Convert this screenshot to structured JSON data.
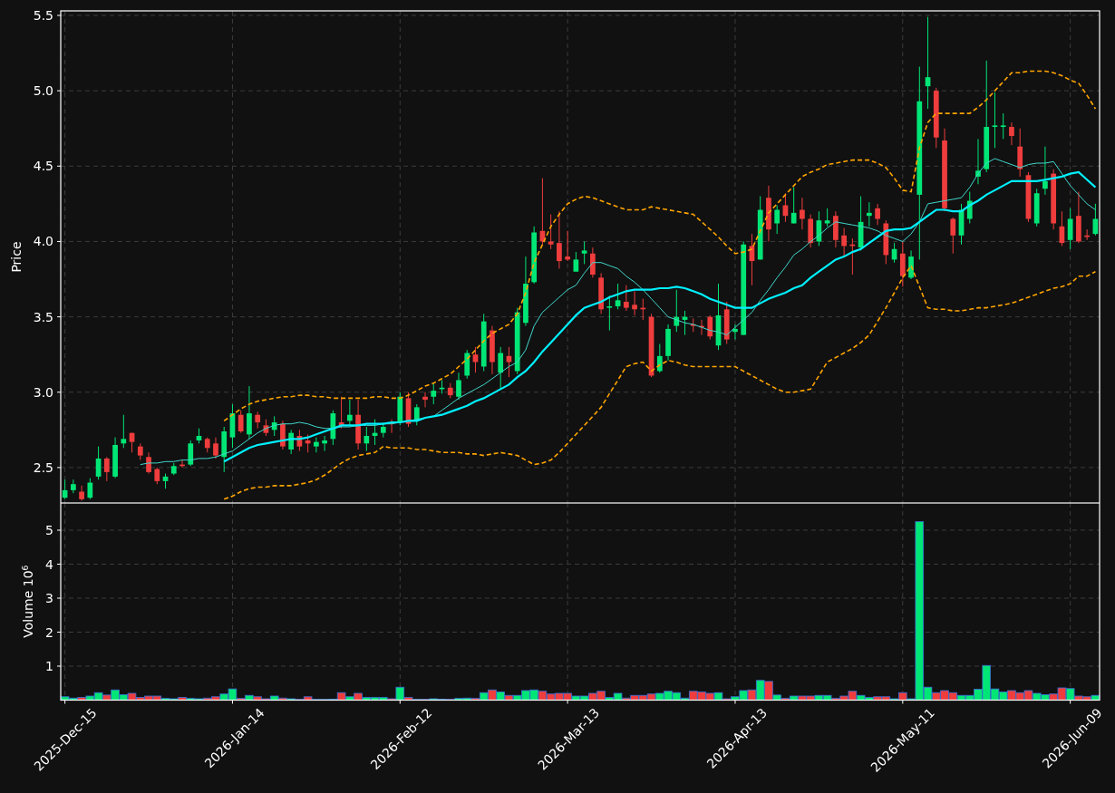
{
  "charts": [
    {
      "chart_data": {
        "type": "candlestick",
        "ylabel": "Price",
        "grid": true,
        "ylim": [
          2.265,
          5.53
        ],
        "categories": [
          null,
          null,
          null,
          null,
          null,
          null,
          null,
          null,
          null,
          null,
          null,
          null,
          null,
          null,
          null,
          null,
          null,
          null,
          null,
          null,
          null,
          null,
          null,
          null,
          null,
          null,
          null,
          null,
          null,
          null,
          null,
          null,
          null,
          null,
          null,
          null,
          null,
          null,
          null,
          null,
          null,
          null,
          null,
          null,
          null,
          null,
          null,
          null,
          null,
          null,
          null,
          null,
          null,
          null,
          null,
          null,
          null,
          null,
          null,
          null,
          null,
          null,
          null,
          null,
          null,
          null,
          null,
          null,
          null,
          null,
          null,
          null,
          null,
          null,
          null,
          null,
          null,
          null,
          null,
          null,
          null,
          null,
          null,
          null,
          null,
          null,
          null,
          null,
          null,
          null,
          null,
          null,
          null,
          null,
          null,
          null,
          null,
          null,
          null,
          null,
          null,
          null,
          null,
          null,
          null,
          null,
          null,
          null,
          null,
          null,
          null,
          null,
          null,
          null,
          null,
          null,
          null,
          null,
          null,
          null,
          null,
          null,
          null,
          null
        ],
        "yticks": [
          {
            "value": 2.5,
            "label": "2.5"
          },
          {
            "value": 3,
            "label": "3.0"
          },
          {
            "value": 3.5,
            "label": "3.5"
          },
          {
            "value": 4,
            "label": "4.0"
          },
          {
            "value": 4.5,
            "label": "4.5"
          },
          {
            "value": 5,
            "label": "5.0"
          },
          {
            "value": 5.5,
            "label": "5.5"
          }
        ],
        "ohlc": [
          [
            2.3,
            2.42,
            2.29,
            2.35
          ],
          [
            2.35,
            2.42,
            2.33,
            2.39
          ],
          [
            2.34,
            2.38,
            2.28,
            2.29
          ],
          [
            2.3,
            2.43,
            2.29,
            2.4
          ],
          [
            2.44,
            2.64,
            2.42,
            2.56
          ],
          [
            2.56,
            2.57,
            2.41,
            2.47
          ],
          [
            2.44,
            2.7,
            2.43,
            2.65
          ],
          [
            2.66,
            2.85,
            2.63,
            2.69
          ],
          [
            2.73,
            2.73,
            2.6,
            2.67
          ],
          [
            2.64,
            2.66,
            2.55,
            2.58
          ],
          [
            2.57,
            2.6,
            2.46,
            2.47
          ],
          [
            2.49,
            2.5,
            2.39,
            2.41
          ],
          [
            2.41,
            2.46,
            2.36,
            2.44
          ],
          [
            2.46,
            2.53,
            2.45,
            2.51
          ],
          [
            2.52,
            2.55,
            2.5,
            2.51
          ],
          [
            2.52,
            2.68,
            2.51,
            2.66
          ],
          [
            2.68,
            2.76,
            2.66,
            2.71
          ],
          [
            2.69,
            2.7,
            2.6,
            2.63
          ],
          [
            2.66,
            2.7,
            2.56,
            2.58
          ],
          [
            2.57,
            2.77,
            2.47,
            2.74
          ],
          [
            2.7,
            2.92,
            2.63,
            2.86
          ],
          [
            2.85,
            2.88,
            2.73,
            2.74
          ],
          [
            2.72,
            3.04,
            2.69,
            2.86
          ],
          [
            2.85,
            2.87,
            2.76,
            2.8
          ],
          [
            2.78,
            2.82,
            2.71,
            2.73
          ],
          [
            2.75,
            2.84,
            2.71,
            2.8
          ],
          [
            2.79,
            2.81,
            2.62,
            2.64
          ],
          [
            2.62,
            2.75,
            2.59,
            2.73
          ],
          [
            2.71,
            2.75,
            2.61,
            2.64
          ],
          [
            2.68,
            2.72,
            2.6,
            2.66
          ],
          [
            2.64,
            2.7,
            2.6,
            2.67
          ],
          [
            2.66,
            2.71,
            2.61,
            2.68
          ],
          [
            2.69,
            2.88,
            2.65,
            2.86
          ],
          [
            2.8,
            2.97,
            2.76,
            2.78
          ],
          [
            2.81,
            2.95,
            2.78,
            2.85
          ],
          [
            2.85,
            2.95,
            2.62,
            2.66
          ],
          [
            2.66,
            2.77,
            2.61,
            2.71
          ],
          [
            2.71,
            2.82,
            2.65,
            2.73
          ],
          [
            2.73,
            2.8,
            2.7,
            2.77
          ],
          [
            2.8,
            2.82,
            2.73,
            2.79
          ],
          [
            2.8,
            3.0,
            2.78,
            2.97
          ],
          [
            2.96,
            3.0,
            2.77,
            2.79
          ],
          [
            2.81,
            2.92,
            2.78,
            2.9
          ],
          [
            2.97,
            3.0,
            2.9,
            2.95
          ],
          [
            2.97,
            3.06,
            2.92,
            3.01
          ],
          [
            3.02,
            3.08,
            2.99,
            3.03
          ],
          [
            3.03,
            3.06,
            2.96,
            2.98
          ],
          [
            2.97,
            3.13,
            2.95,
            3.08
          ],
          [
            3.11,
            3.28,
            3.09,
            3.26
          ],
          [
            3.25,
            3.3,
            3.13,
            3.2
          ],
          [
            3.17,
            3.52,
            3.14,
            3.47
          ],
          [
            3.41,
            3.44,
            3.12,
            3.2
          ],
          [
            3.13,
            3.3,
            3.02,
            3.26
          ],
          [
            3.24,
            3.3,
            3.1,
            3.2
          ],
          [
            3.14,
            3.56,
            3.12,
            3.53
          ],
          [
            3.46,
            3.9,
            3.44,
            3.72
          ],
          [
            3.73,
            4.1,
            3.72,
            4.06
          ],
          [
            4.07,
            4.42,
            3.98,
            4.0
          ],
          [
            4.0,
            4.18,
            3.95,
            3.98
          ],
          [
            3.99,
            4.2,
            3.82,
            3.87
          ],
          [
            3.9,
            4.07,
            3.87,
            3.88
          ],
          [
            3.8,
            3.93,
            3.8,
            3.88
          ],
          [
            3.92,
            4.0,
            3.85,
            3.94
          ],
          [
            3.92,
            3.96,
            3.76,
            3.78
          ],
          [
            3.76,
            3.79,
            3.52,
            3.55
          ],
          [
            3.56,
            3.64,
            3.41,
            3.57
          ],
          [
            3.57,
            3.72,
            3.55,
            3.61
          ],
          [
            3.6,
            3.71,
            3.54,
            3.56
          ],
          [
            3.58,
            3.67,
            3.51,
            3.55
          ],
          [
            3.56,
            3.62,
            3.48,
            3.55
          ],
          [
            3.5,
            3.52,
            3.1,
            3.11
          ],
          [
            3.14,
            3.32,
            3.13,
            3.24
          ],
          [
            3.24,
            3.45,
            3.21,
            3.42
          ],
          [
            3.44,
            3.68,
            3.4,
            3.5
          ],
          [
            3.48,
            3.54,
            3.38,
            3.5
          ],
          [
            3.45,
            3.49,
            3.4,
            3.44
          ],
          [
            3.44,
            3.48,
            3.38,
            3.43
          ],
          [
            3.5,
            3.51,
            3.35,
            3.37
          ],
          [
            3.31,
            3.72,
            3.28,
            3.51
          ],
          [
            3.55,
            3.6,
            3.32,
            3.35
          ],
          [
            3.4,
            3.45,
            3.35,
            3.42
          ],
          [
            3.38,
            4.0,
            3.38,
            3.98
          ],
          [
            3.97,
            4.05,
            3.71,
            3.87
          ],
          [
            3.88,
            4.3,
            3.88,
            4.21
          ],
          [
            4.29,
            4.37,
            4.0,
            4.08
          ],
          [
            4.12,
            4.24,
            4.05,
            4.21
          ],
          [
            4.24,
            4.32,
            4.13,
            4.17
          ],
          [
            4.12,
            4.36,
            4.12,
            4.19
          ],
          [
            4.21,
            4.29,
            4.08,
            4.15
          ],
          [
            4.15,
            4.18,
            3.96,
            3.99
          ],
          [
            4.0,
            4.2,
            3.97,
            4.14
          ],
          [
            4.12,
            4.22,
            4.1,
            4.14
          ],
          [
            4.17,
            4.2,
            3.96,
            4.01
          ],
          [
            4.04,
            4.09,
            3.9,
            3.97
          ],
          [
            3.98,
            4.02,
            3.78,
            3.97
          ],
          [
            3.96,
            4.3,
            3.94,
            4.13
          ],
          [
            4.17,
            4.26,
            4.1,
            4.19
          ],
          [
            4.22,
            4.25,
            4.11,
            4.15
          ],
          [
            4.12,
            4.14,
            3.85,
            3.91
          ],
          [
            3.88,
            3.99,
            3.86,
            3.95
          ],
          [
            3.92,
            4.0,
            3.7,
            3.77
          ],
          [
            3.76,
            3.94,
            3.75,
            3.9
          ],
          [
            4.31,
            5.16,
            3.88,
            4.93
          ],
          [
            5.03,
            5.49,
            4.88,
            5.09
          ],
          [
            5.0,
            5.02,
            4.62,
            4.69
          ],
          [
            4.67,
            4.75,
            4.2,
            4.22
          ],
          [
            4.15,
            4.16,
            3.92,
            4.04
          ],
          [
            4.04,
            4.25,
            3.98,
            4.21
          ],
          [
            4.15,
            4.33,
            4.12,
            4.27
          ],
          [
            4.43,
            4.68,
            4.38,
            4.47
          ],
          [
            4.48,
            5.2,
            4.46,
            4.76
          ],
          [
            4.76,
            4.99,
            4.62,
            4.77
          ],
          [
            4.76,
            4.85,
            4.68,
            4.77
          ],
          [
            4.76,
            4.79,
            4.64,
            4.7
          ],
          [
            4.63,
            4.75,
            4.43,
            4.48
          ],
          [
            4.44,
            4.46,
            4.13,
            4.15
          ],
          [
            4.12,
            4.35,
            4.1,
            4.32
          ],
          [
            4.35,
            4.63,
            4.31,
            4.4
          ],
          [
            4.45,
            4.48,
            4.08,
            4.12
          ],
          [
            4.1,
            4.2,
            3.97,
            3.99
          ],
          [
            4.01,
            4.22,
            3.95,
            4.15
          ],
          [
            4.17,
            4.33,
            3.99,
            4.0
          ],
          [
            4.04,
            4.08,
            4.01,
            4.03
          ],
          [
            4.05,
            4.25,
            4.04,
            4.15
          ]
        ],
        "series": [
          {
            "type": "line",
            "color": "#40d8cc",
            "values": [
              null,
              null,
              null,
              null,
              null,
              null,
              null,
              null,
              null,
              2.52,
              2.53,
              2.53,
              2.54,
              2.54,
              2.55,
              2.55,
              2.56,
              2.56,
              2.57,
              2.59,
              2.61,
              2.65,
              2.69,
              2.73,
              2.76,
              2.78,
              2.79,
              2.79,
              2.8,
              2.79,
              2.77,
              2.76,
              2.76,
              2.77,
              2.77,
              2.78,
              2.78,
              2.78,
              2.79,
              2.79,
              2.8,
              2.81,
              2.82,
              2.83,
              2.84,
              2.88,
              2.92,
              2.96,
              2.99,
              3.02,
              3.05,
              3.09,
              3.13,
              3.17,
              3.2,
              3.28,
              3.44,
              3.53,
              3.58,
              3.63,
              3.68,
              3.71,
              3.79,
              3.86,
              3.86,
              3.84,
              3.82,
              3.77,
              3.73,
              3.68,
              3.62,
              3.56,
              3.5,
              3.48,
              3.46,
              3.45,
              3.43,
              3.41,
              3.4,
              3.38,
              3.43,
              3.48,
              3.53,
              3.61,
              3.68,
              3.76,
              3.83,
              3.91,
              3.95,
              4.0,
              4.04,
              4.09,
              4.13,
              4.12,
              4.11,
              4.1,
              4.09,
              4.07,
              4.04,
              4.02,
              4.0,
              4.05,
              4.13,
              4.25,
              4.26,
              4.27,
              4.28,
              4.29,
              4.36,
              4.45,
              4.52,
              4.55,
              4.53,
              4.51,
              4.49,
              4.51,
              4.52,
              4.52,
              4.53,
              4.45,
              4.37,
              4.31,
              4.25,
              4.21
            ]
          },
          {
            "type": "line",
            "color": "#00f0ff",
            "values": [
              null,
              null,
              null,
              null,
              null,
              null,
              null,
              null,
              null,
              null,
              null,
              null,
              null,
              null,
              null,
              null,
              null,
              null,
              null,
              2.54,
              2.57,
              2.6,
              2.63,
              2.65,
              2.66,
              2.67,
              2.68,
              2.69,
              2.69,
              2.7,
              2.72,
              2.74,
              2.76,
              2.78,
              2.78,
              2.78,
              2.79,
              2.79,
              2.79,
              2.8,
              2.8,
              2.81,
              2.81,
              2.83,
              2.84,
              2.85,
              2.87,
              2.89,
              2.91,
              2.94,
              2.96,
              2.99,
              3.02,
              3.05,
              3.1,
              3.14,
              3.2,
              3.27,
              3.33,
              3.39,
              3.45,
              3.51,
              3.56,
              3.58,
              3.6,
              3.63,
              3.65,
              3.67,
              3.68,
              3.68,
              3.68,
              3.69,
              3.69,
              3.7,
              3.69,
              3.67,
              3.65,
              3.62,
              3.6,
              3.58,
              3.56,
              3.56,
              3.56,
              3.59,
              3.62,
              3.64,
              3.66,
              3.69,
              3.71,
              3.76,
              3.8,
              3.84,
              3.88,
              3.9,
              3.93,
              3.95,
              3.99,
              4.03,
              4.07,
              4.08,
              4.08,
              4.09,
              4.13,
              4.17,
              4.21,
              4.21,
              4.2,
              4.2,
              4.24,
              4.27,
              4.31,
              4.34,
              4.37,
              4.4,
              4.4,
              4.4,
              4.4,
              4.41,
              4.42,
              4.43,
              4.45,
              4.46,
              4.41,
              4.36
            ]
          },
          {
            "type": "line",
            "line_style": "dashed",
            "color": "#ffa500",
            "values": [
              null,
              null,
              null,
              null,
              null,
              null,
              null,
              null,
              null,
              null,
              null,
              null,
              null,
              null,
              null,
              null,
              null,
              null,
              null,
              2.81,
              2.85,
              2.89,
              2.92,
              2.94,
              2.95,
              2.96,
              2.97,
              2.97,
              2.98,
              2.98,
              2.97,
              2.97,
              2.96,
              2.96,
              2.96,
              2.96,
              2.96,
              2.97,
              2.97,
              2.96,
              2.96,
              2.98,
              3.01,
              3.04,
              3.06,
              3.09,
              3.12,
              3.17,
              3.22,
              3.28,
              3.34,
              3.39,
              3.42,
              3.45,
              3.52,
              3.66,
              3.86,
              3.98,
              4.1,
              4.18,
              4.25,
              4.28,
              4.3,
              4.29,
              4.27,
              4.25,
              4.23,
              4.21,
              4.21,
              4.21,
              4.23,
              4.22,
              4.21,
              4.2,
              4.19,
              4.18,
              4.13,
              4.08,
              4.03,
              3.97,
              3.92,
              3.93,
              3.95,
              4.07,
              4.19,
              4.25,
              4.31,
              4.37,
              4.43,
              4.46,
              4.48,
              4.51,
              4.52,
              4.53,
              4.54,
              4.54,
              4.54,
              4.52,
              4.49,
              4.42,
              4.34,
              4.33,
              4.62,
              4.79,
              4.85,
              4.85,
              4.85,
              4.85,
              4.85,
              4.89,
              4.94,
              5.0,
              5.06,
              5.12,
              5.12,
              5.13,
              5.13,
              5.13,
              5.12,
              5.1,
              5.07,
              5.05,
              4.97,
              4.88
            ]
          },
          {
            "type": "line",
            "line_style": "dashed",
            "color": "#ffa500",
            "values": [
              null,
              null,
              null,
              null,
              null,
              null,
              null,
              null,
              null,
              null,
              null,
              null,
              null,
              null,
              null,
              null,
              null,
              null,
              null,
              2.29,
              2.31,
              2.34,
              2.36,
              2.37,
              2.37,
              2.38,
              2.38,
              2.38,
              2.39,
              2.4,
              2.42,
              2.45,
              2.49,
              2.53,
              2.56,
              2.58,
              2.59,
              2.6,
              2.64,
              2.63,
              2.63,
              2.63,
              2.62,
              2.62,
              2.61,
              2.6,
              2.6,
              2.6,
              2.59,
              2.59,
              2.58,
              2.59,
              2.6,
              2.59,
              2.58,
              2.55,
              2.52,
              2.53,
              2.55,
              2.6,
              2.66,
              2.72,
              2.78,
              2.84,
              2.9,
              2.99,
              3.08,
              3.17,
              3.19,
              3.2,
              3.14,
              3.18,
              3.21,
              3.2,
              3.18,
              3.17,
              3.17,
              3.17,
              3.17,
              3.17,
              3.17,
              3.14,
              3.11,
              3.08,
              3.05,
              3.02,
              3.0,
              3.0,
              3.01,
              3.02,
              3.11,
              3.2,
              3.23,
              3.26,
              3.29,
              3.33,
              3.38,
              3.47,
              3.56,
              3.66,
              3.76,
              3.84,
              3.7,
              3.56,
              3.55,
              3.55,
              3.54,
              3.54,
              3.55,
              3.56,
              3.56,
              3.57,
              3.58,
              3.59,
              3.61,
              3.63,
              3.65,
              3.67,
              3.69,
              3.7,
              3.72,
              3.77,
              3.77,
              3.8
            ]
          }
        ]
      }
    },
    {
      "chart_data": {
        "type": "bar",
        "ylabel": "Volume  10$^{6}$",
        "grid": true,
        "ylim": [
          0,
          5.8
        ],
        "categories": [
          "2025-Dec-15",
          null,
          null,
          null,
          null,
          null,
          null,
          null,
          null,
          null,
          null,
          null,
          null,
          null,
          null,
          null,
          null,
          null,
          null,
          null,
          "2026-Jan-14",
          null,
          null,
          null,
          null,
          null,
          null,
          null,
          null,
          null,
          null,
          null,
          null,
          null,
          null,
          null,
          null,
          null,
          null,
          null,
          "2026-Feb-12",
          null,
          null,
          null,
          null,
          null,
          null,
          null,
          null,
          null,
          null,
          null,
          null,
          null,
          null,
          null,
          null,
          null,
          null,
          null,
          "2026-Mar-13",
          null,
          null,
          null,
          null,
          null,
          null,
          null,
          null,
          null,
          null,
          null,
          null,
          null,
          null,
          null,
          null,
          null,
          null,
          null,
          "2026-Apr-13",
          null,
          null,
          null,
          null,
          null,
          null,
          null,
          null,
          null,
          null,
          null,
          null,
          null,
          null,
          null,
          null,
          null,
          null,
          null,
          "2026-May-11",
          null,
          null,
          null,
          null,
          null,
          null,
          null,
          null,
          null,
          null,
          null,
          null,
          null,
          null,
          null,
          null,
          null,
          null,
          null,
          "2026-Jun-09",
          null,
          null,
          null
        ],
        "yticks": [
          1,
          2,
          3,
          4,
          5
        ],
        "series": [
          {
            "color": "#3a6fd8",
            "values": [
              0.1,
              0.06,
              0.08,
              0.12,
              0.22,
              0.15,
              0.3,
              0.16,
              0.2,
              0.08,
              0.12,
              0.12,
              0.05,
              0.04,
              0.08,
              0.05,
              0.04,
              0.06,
              0.1,
              0.18,
              0.33,
              0.05,
              0.14,
              0.1,
              0.04,
              0.12,
              0.06,
              0.04,
              0.02,
              0.1,
              0.02,
              0.02,
              0.03,
              0.22,
              0.1,
              0.2,
              0.08,
              0.08,
              0.08,
              0.04,
              0.38,
              0.08,
              0.02,
              0.02,
              0.04,
              0.03,
              0.02,
              0.05,
              0.06,
              0.05,
              0.22,
              0.3,
              0.24,
              0.14,
              0.14,
              0.28,
              0.3,
              0.26,
              0.18,
              0.2,
              0.2,
              0.12,
              0.12,
              0.2,
              0.26,
              0.08,
              0.2,
              0.06,
              0.14,
              0.14,
              0.18,
              0.2,
              0.26,
              0.22,
              0.06,
              0.26,
              0.24,
              0.2,
              0.22,
              0.04,
              0.1,
              0.28,
              0.3,
              0.58,
              0.55,
              0.15,
              0.05,
              0.12,
              0.12,
              0.12,
              0.14,
              0.14,
              0.05,
              0.12,
              0.26,
              0.14,
              0.08,
              0.1,
              0.1,
              0.04,
              0.22,
              0.04,
              5.25,
              0.38,
              0.22,
              0.28,
              0.22,
              0.14,
              0.14,
              0.32,
              1.02,
              0.33,
              0.24,
              0.28,
              0.22,
              0.28,
              0.2,
              0.16,
              0.18,
              0.36,
              0.34,
              0.12,
              0.1,
              0.14
            ]
          }
        ]
      }
    }
  ]
}
